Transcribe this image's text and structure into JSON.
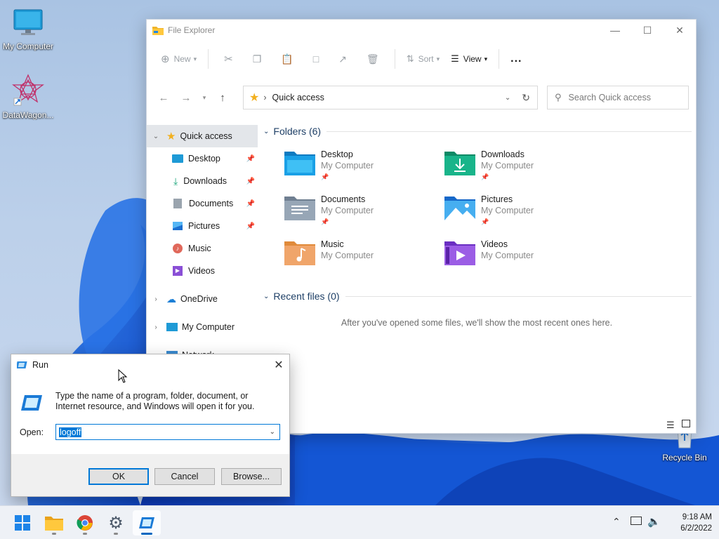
{
  "desktop": {
    "icons": [
      {
        "label": "My Computer"
      },
      {
        "label": "DataWagon..."
      },
      {
        "label": "Recycle Bin"
      }
    ]
  },
  "explorer": {
    "title": "File Explorer",
    "toolbar": {
      "new": "New",
      "sort": "Sort",
      "view": "View",
      "more": "..."
    },
    "address": {
      "path": "Quick access"
    },
    "search": {
      "placeholder": "Search Quick access"
    },
    "nav": [
      {
        "label": "Quick access"
      },
      {
        "label": "Desktop"
      },
      {
        "label": "Downloads"
      },
      {
        "label": "Documents"
      },
      {
        "label": "Pictures"
      },
      {
        "label": "Music"
      },
      {
        "label": "Videos"
      },
      {
        "label": "OneDrive"
      },
      {
        "label": "My Computer"
      },
      {
        "label": "Network"
      }
    ],
    "folders_header": "Folders (6)",
    "folders": [
      {
        "name": "Desktop",
        "location": "My Computer"
      },
      {
        "name": "Downloads",
        "location": "My Computer"
      },
      {
        "name": "Documents",
        "location": "My Computer"
      },
      {
        "name": "Pictures",
        "location": "My Computer"
      },
      {
        "name": "Music",
        "location": "My Computer"
      },
      {
        "name": "Videos",
        "location": "My Computer"
      }
    ],
    "recent_header": "Recent files (0)",
    "recent_empty": "After you've opened some files, we'll show the most recent ones here."
  },
  "run": {
    "title": "Run",
    "description": "Type the name of a program, folder, document, or Internet resource, and Windows will open it for you.",
    "open_label": "Open:",
    "open_value": "logoff",
    "ok": "OK",
    "cancel": "Cancel",
    "browse": "Browse..."
  },
  "taskbar": {
    "time": "9:18 AM",
    "date": "6/2/2022"
  },
  "colors": {
    "accent": "#0067c0",
    "folder": "#f0b429"
  }
}
